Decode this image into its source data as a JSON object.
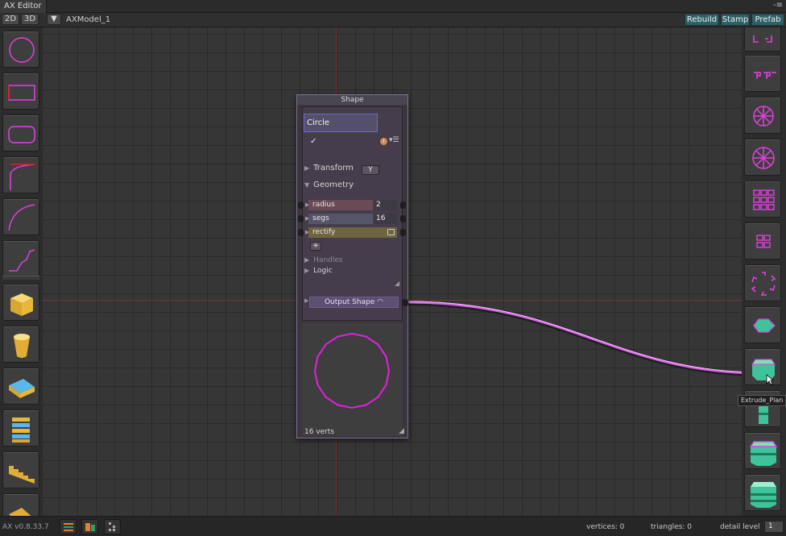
{
  "window": {
    "tab_title": "AX Editor",
    "menu_glyph": "-≡"
  },
  "toolbar": {
    "btn_2d": "2D",
    "btn_3d": "3D",
    "dropdown_glyph": "▼",
    "model_name": "AXModel_1",
    "rebuild": "Rebuild",
    "stamp": "Stamp",
    "prefab": "Prefab"
  },
  "left_palette": {
    "tools": [
      "circle-shape",
      "rectangle-shape",
      "rounded-rectangle-shape",
      "corner-curve-shape",
      "arc-curve-shape",
      "stair-line-shape",
      "box-mesh",
      "cylinder-mesh",
      "slab-mesh",
      "stacked-floors-mesh",
      "stair-mesh",
      "ramp-mesh"
    ]
  },
  "right_palette": {
    "tools": [
      "corner-grid-repeater",
      "pair-repeater",
      "radial-repeater",
      "radial-repeater-2",
      "grid-repeater",
      "grid-repeater-small",
      "ring-repeater",
      "plan-mesh",
      "extrude-plan",
      "extrude-plan-column",
      "extrude-plan-tower",
      "extrude-plan-tower-2"
    ]
  },
  "node": {
    "title": "Shape",
    "name": "Circle",
    "checkbox_glyph": "✓",
    "info_glyph": "i",
    "options_glyph": "▾☰",
    "transform_label": "Transform",
    "transform_axis": "Y",
    "geometry_label": "Geometry",
    "params": {
      "radius_label": "radius",
      "radius_value": "2",
      "segs_label": "segs",
      "segs_value": "16",
      "rectify_label": "rectify"
    },
    "add_glyph": "+",
    "handles_label": "Handles",
    "logic_label": "Logic",
    "output_label": "Output Shape",
    "verts_text": "16 verts"
  },
  "tooltip": "Extrude_Plan",
  "status": {
    "version": "AX v0.8.33.7",
    "vertices": "vertices: 0",
    "triangles": "triangles: 0",
    "detail_label": "detail level",
    "detail_value": "1"
  },
  "colors": {
    "accent_teal": "#2f5f68",
    "wire_magenta": "#d860e8",
    "shape_magenta": "#e020e0",
    "node_border": "#7d7393"
  }
}
